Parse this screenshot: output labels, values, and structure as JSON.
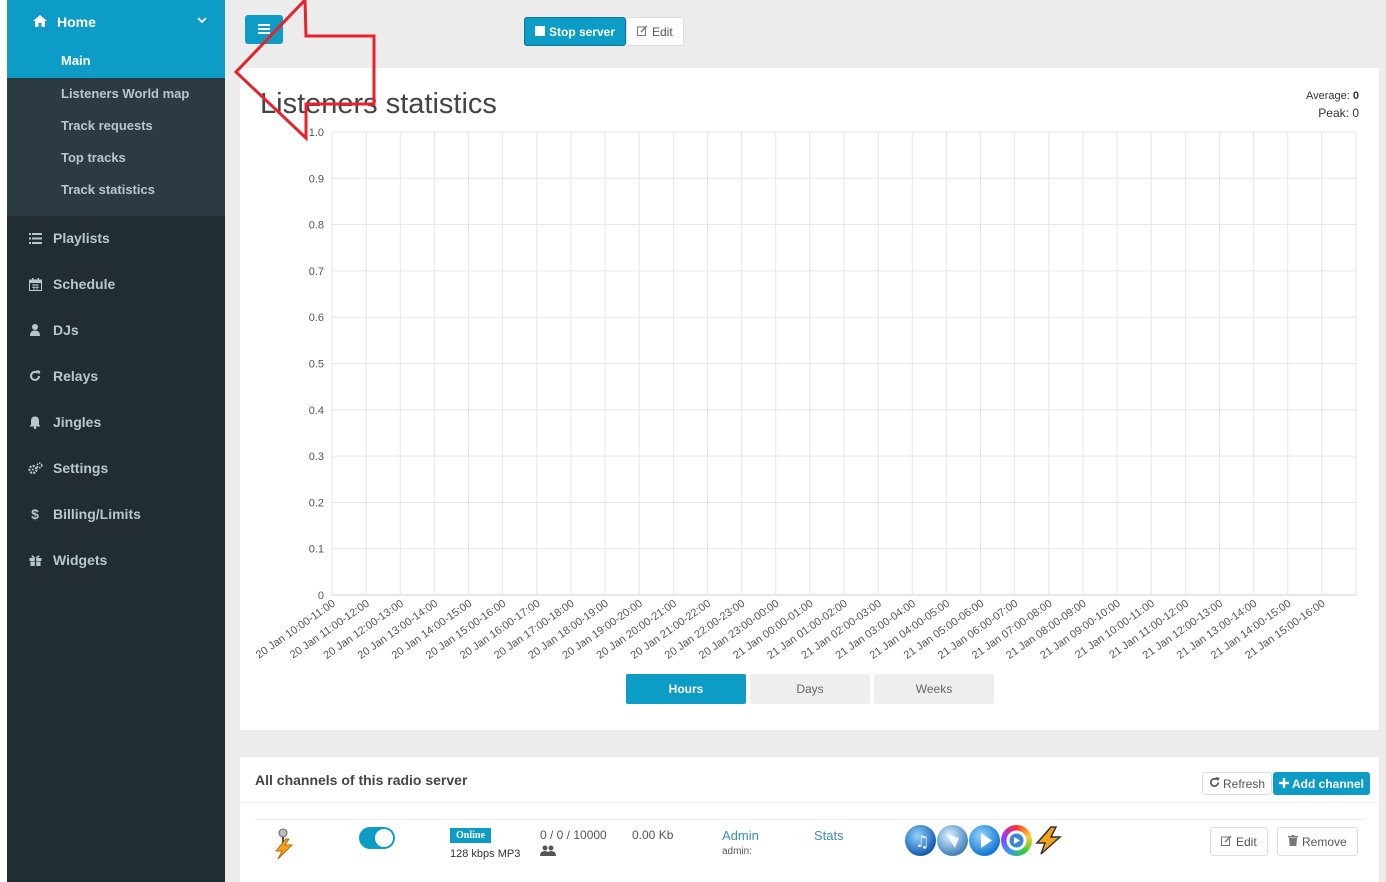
{
  "sidebar": {
    "home_label": "Home",
    "main_label": "Main",
    "submenu": [
      "Listeners World map",
      "Track requests",
      "Top tracks",
      "Track statistics"
    ],
    "items": [
      {
        "label": "Playlists",
        "icon": "list-icon"
      },
      {
        "label": "Schedule",
        "icon": "calendar-icon"
      },
      {
        "label": "DJs",
        "icon": "user-icon"
      },
      {
        "label": "Relays",
        "icon": "refresh-icon"
      },
      {
        "label": "Jingles",
        "icon": "bell-icon"
      },
      {
        "label": "Settings",
        "icon": "cogs-icon"
      },
      {
        "label": "Billing/Limits",
        "icon": "dollar-icon"
      },
      {
        "label": "Widgets",
        "icon": "gift-icon"
      }
    ]
  },
  "toolbar": {
    "stop_label": "Stop server",
    "edit_label": "Edit"
  },
  "stats_panel": {
    "title": "Listeners statistics",
    "average_label": "Average:",
    "average_value": "0",
    "peak_text": "Peak: 0",
    "tabs": [
      "Hours",
      "Days",
      "Weeks"
    ],
    "active_tab": "Hours"
  },
  "chart_data": {
    "type": "line",
    "ylim": [
      0,
      1.0
    ],
    "yticks": [
      "0",
      "0.1",
      "0.2",
      "0.3",
      "0.4",
      "0.5",
      "0.6",
      "0.7",
      "0.8",
      "0.9",
      "1.0"
    ],
    "grid": true,
    "categories": [
      "20 Jan 10:00-11:00",
      "20 Jan 11:00-12:00",
      "20 Jan 12:00-13:00",
      "20 Jan 13:00-14:00",
      "20 Jan 14:00-15:00",
      "20 Jan 15:00-16:00",
      "20 Jan 16:00-17:00",
      "20 Jan 17:00-18:00",
      "20 Jan 18:00-19:00",
      "20 Jan 19:00-20:00",
      "20 Jan 20:00-21:00",
      "20 Jan 21:00-22:00",
      "20 Jan 22:00-23:00",
      "20 Jan 23:00-00:00",
      "21 Jan 00:00-01:00",
      "21 Jan 01:00-02:00",
      "21 Jan 02:00-03:00",
      "21 Jan 03:00-04:00",
      "21 Jan 04:00-05:00",
      "21 Jan 05:00-06:00",
      "21 Jan 06:00-07:00",
      "21 Jan 07:00-08:00",
      "21 Jan 08:00-09:00",
      "21 Jan 09:00-10:00",
      "21 Jan 10:00-11:00",
      "21 Jan 11:00-12:00",
      "21 Jan 12:00-13:00",
      "21 Jan 13:00-14:00",
      "21 Jan 14:00-15:00",
      "21 Jan 15:00-16:00"
    ],
    "values": [
      0,
      0,
      0,
      0,
      0,
      0,
      0,
      0,
      0,
      0,
      0,
      0,
      0,
      0,
      0,
      0,
      0,
      0,
      0,
      0,
      0,
      0,
      0,
      0,
      0,
      0,
      0,
      0,
      0,
      0
    ]
  },
  "channels_panel": {
    "title": "All channels of this radio server",
    "refresh_label": "Refresh",
    "add_label": "Add channel",
    "channel": {
      "status": "Online",
      "bitrate": "128 kbps MP3",
      "counts": "0 / 0 / 10000",
      "traffic": "0.00 Kb",
      "admin_link": "Admin",
      "admin_user": "admin:",
      "stats_link": "Stats",
      "players": [
        "itunes-icon",
        "windows-media-player-icon",
        "play-icon",
        "quicktime-icon",
        "winamp-icon"
      ],
      "edit_label": "Edit",
      "remove_label": "Remove"
    }
  },
  "colors": {
    "accent": "#0c9cc6",
    "sidebar": "#222d32",
    "submenu": "#2c3b41",
    "arrow": "#e8212b"
  }
}
